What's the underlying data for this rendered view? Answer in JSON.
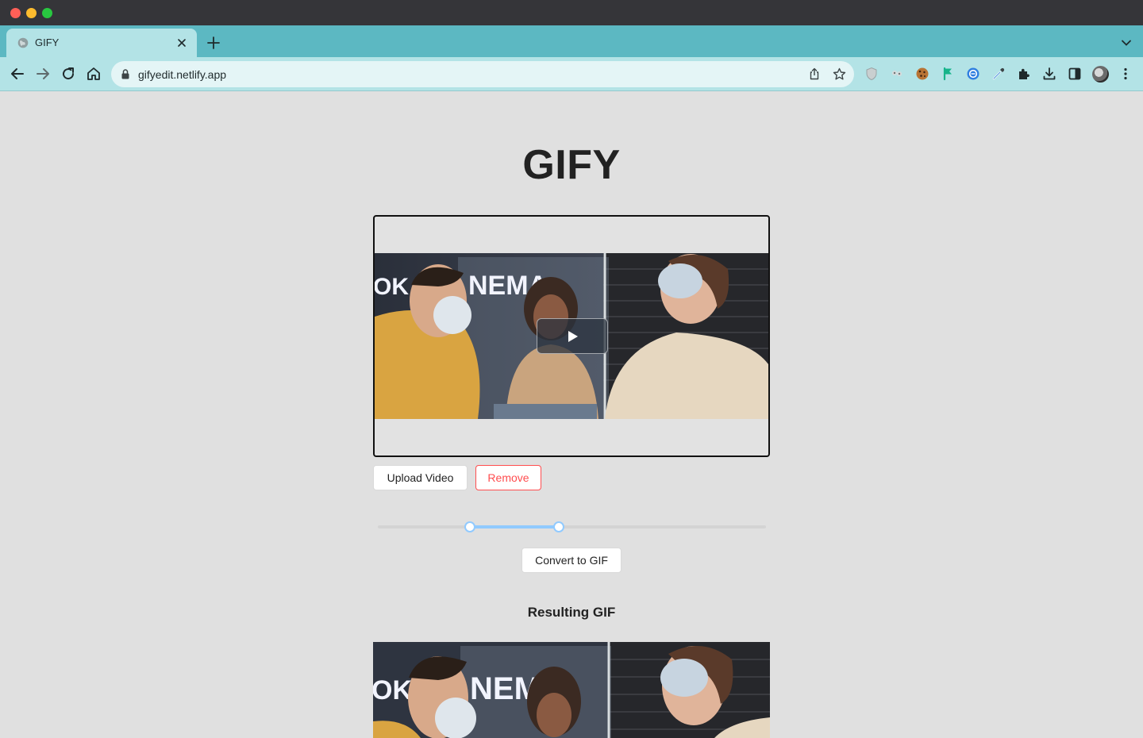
{
  "browser": {
    "tab_title": "GIFY",
    "url": "gifyedit.netlify.app",
    "colors": {
      "titlebar": "#353539",
      "tabstrip": "#5cb8c2",
      "toolbar": "#b3e3e6"
    }
  },
  "app": {
    "title": "GIFY",
    "upload_label": "Upload Video",
    "remove_label": "Remove",
    "convert_label": "Convert to GIF",
    "result_heading": "Resulting GIF",
    "video_frame_text": "NEMA",
    "video_frame_text_left": "OK",
    "trim_range": {
      "start_fraction": 0.238,
      "end_fraction": 0.467
    },
    "accent": "#91caff",
    "danger": "#ff4d4f"
  }
}
